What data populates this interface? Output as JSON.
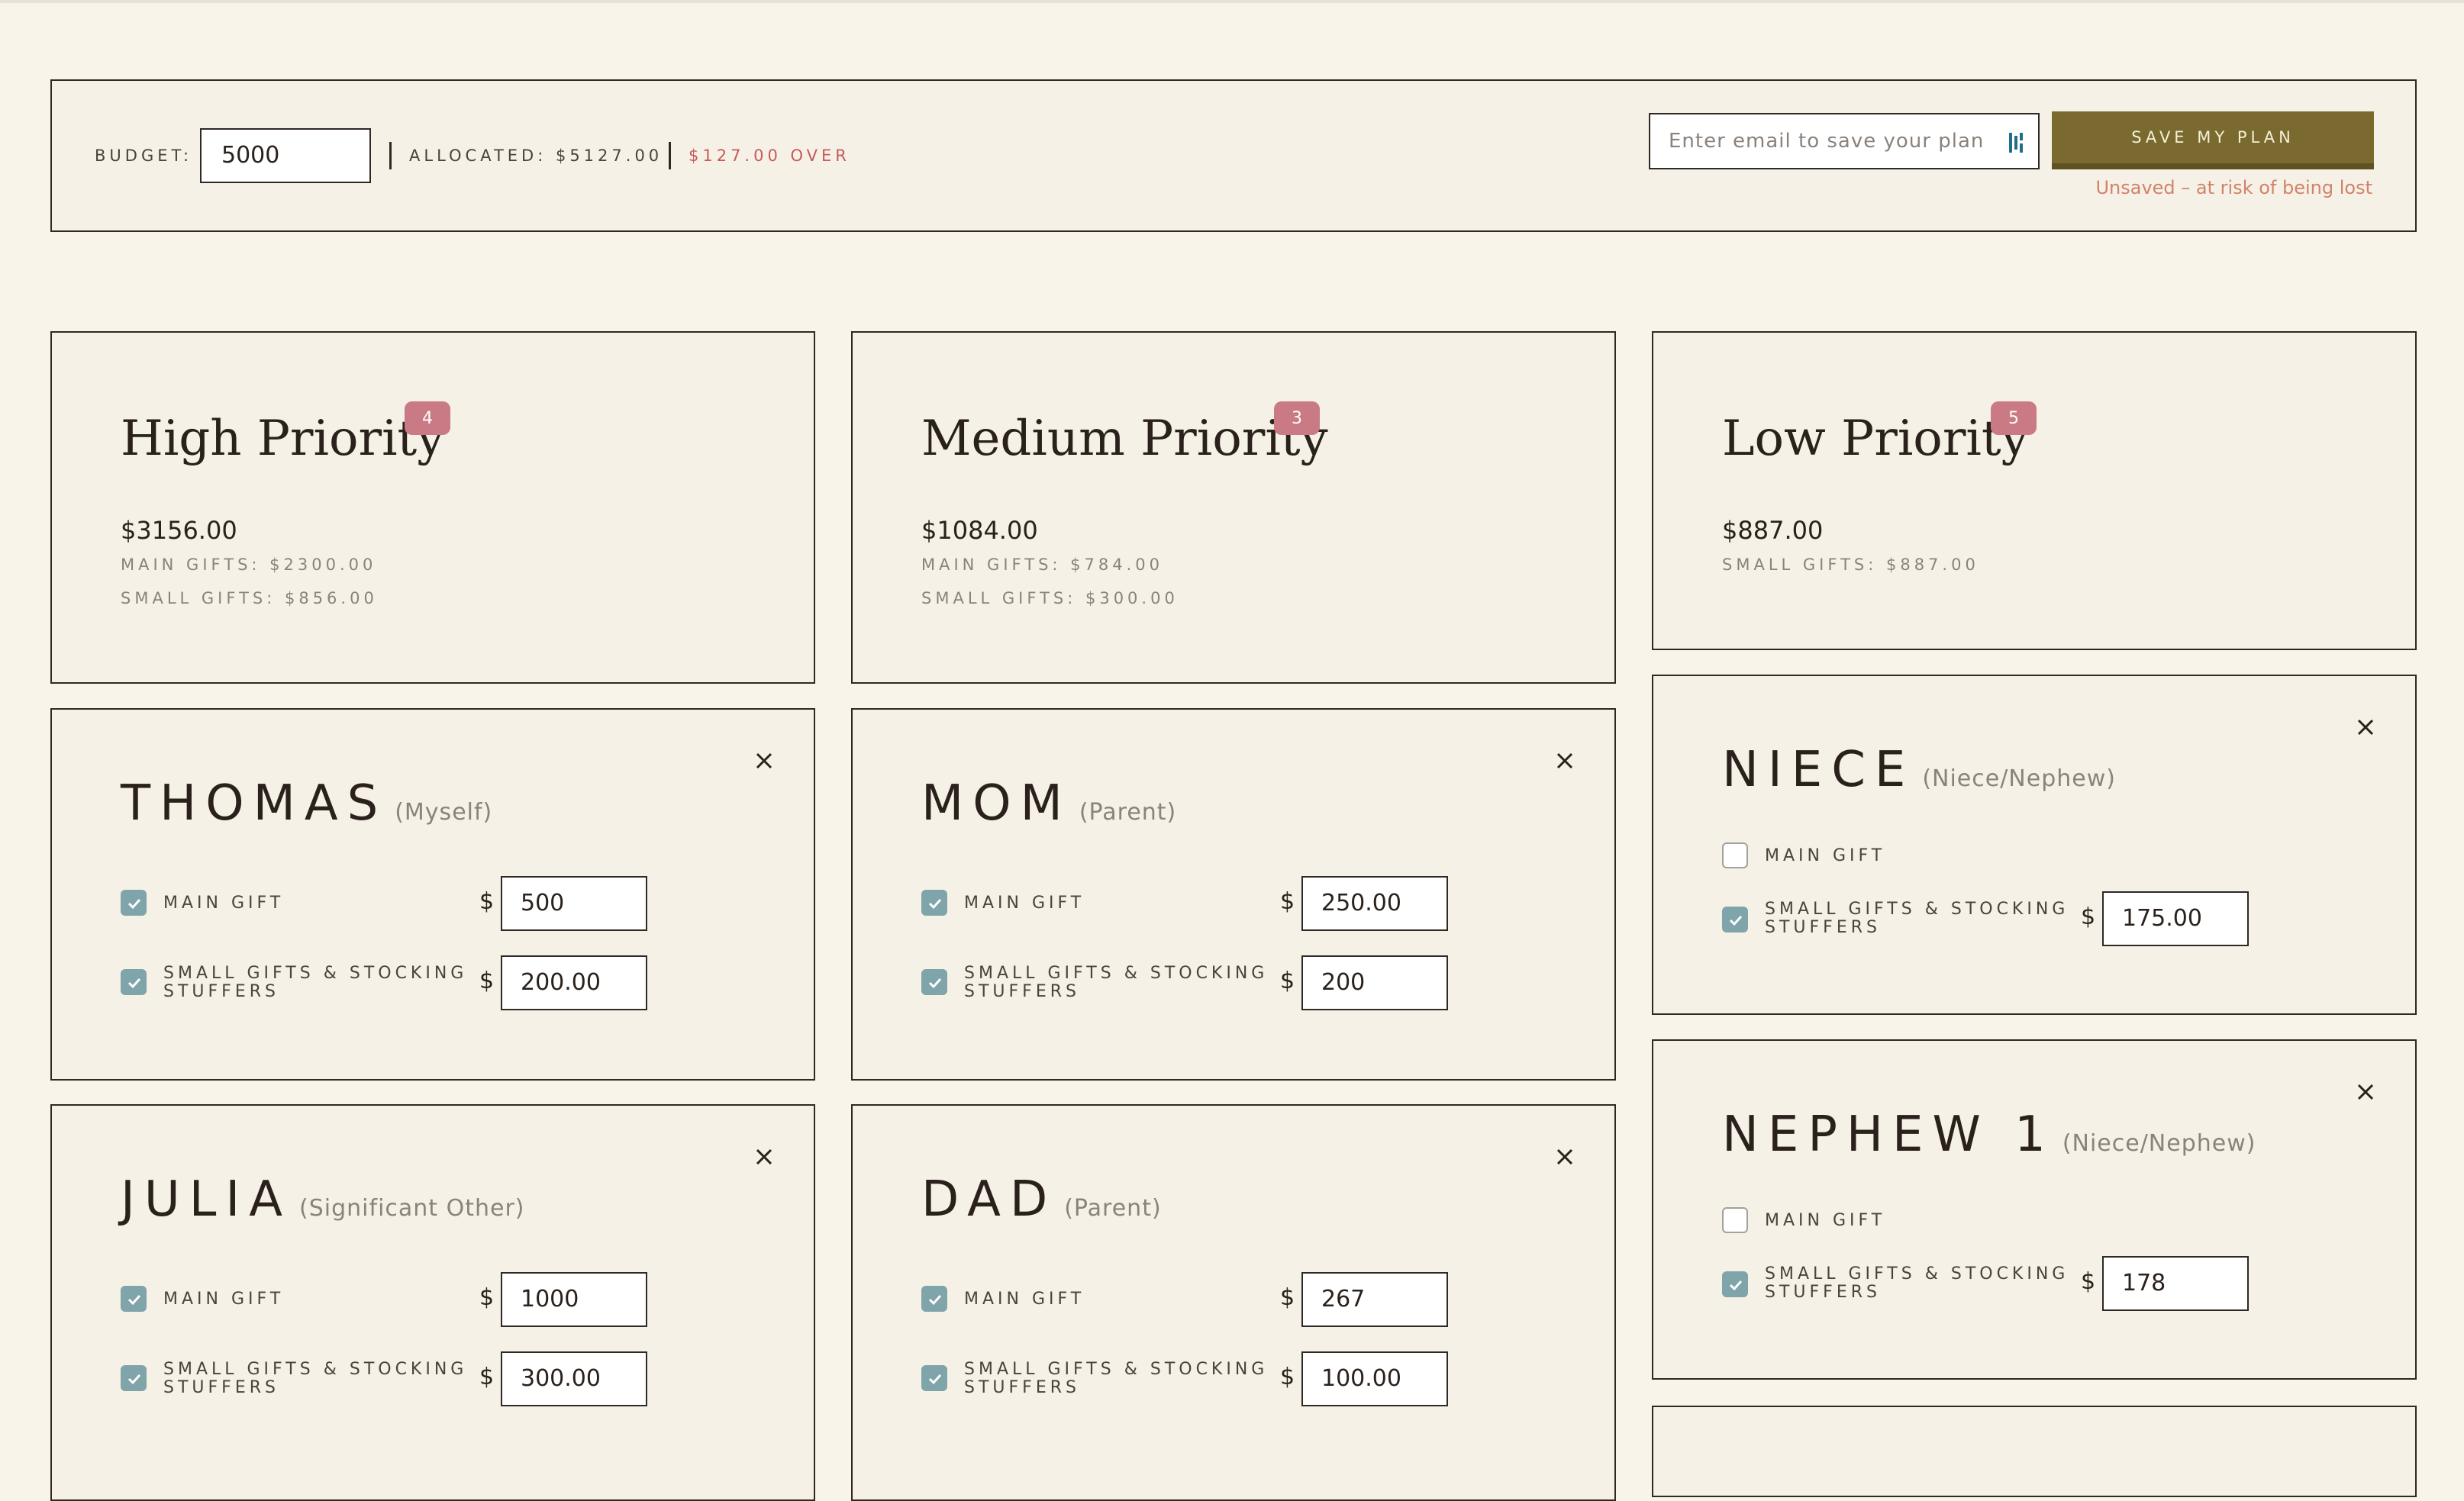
{
  "budget_bar": {
    "budget_label": "BUDGET:",
    "budget_value": "5000",
    "allocated_label": "ALLOCATED:  $5127.00",
    "over_label": "$127.00 OVER",
    "email_placeholder": "Enter email to save your plan",
    "save_label": "SAVE MY PLAN",
    "unsaved_note": "Unsaved – at risk of being lost"
  },
  "priorities": {
    "high": {
      "title": "High Priority",
      "count": "4",
      "total": "$3156.00",
      "main": "MAIN GIFTS: $2300.00",
      "small": "SMALL GIFTS: $856.00"
    },
    "medium": {
      "title": "Medium Priority",
      "count": "3",
      "total": "$1084.00",
      "main": "MAIN GIFTS: $784.00",
      "small": "SMALL GIFTS: $300.00"
    },
    "low": {
      "title": "Low Priority",
      "count": "5",
      "total": "$887.00",
      "small": "SMALL GIFTS: $887.00"
    }
  },
  "labels": {
    "main_gift": "MAIN GIFT",
    "small_gifts": "SMALL GIFTS & STOCKING STUFFERS",
    "dollar": "$"
  },
  "people": {
    "thomas": {
      "name": "THOMAS",
      "relation": "(Myself)",
      "main_checked": true,
      "main": "500",
      "small_checked": true,
      "small": "200.00"
    },
    "mom": {
      "name": "MOM",
      "relation": "(Parent)",
      "main_checked": true,
      "main": "250.00",
      "small_checked": true,
      "small": "200"
    },
    "niece": {
      "name": "NIECE",
      "relation": "(Niece/Nephew)",
      "main_checked": false,
      "small_checked": true,
      "small": "175.00"
    },
    "nephew1": {
      "name": "NEPHEW 1",
      "relation": "(Niece/Nephew)",
      "main_checked": false,
      "small_checked": true,
      "small": "178"
    },
    "julia": {
      "name": "JULIA",
      "relation": "(Significant Other)",
      "main_checked": true,
      "main": "1000",
      "small_checked": true,
      "small": "300.00"
    },
    "dad": {
      "name": "DAD",
      "relation": "(Parent)",
      "main_checked": true,
      "main": "267",
      "small_checked": true,
      "small": "100.00"
    }
  },
  "colors": {
    "accent": "#7a6a2f",
    "badge": "#c97a84",
    "over": "#c85a5a",
    "check": "#7fa4aa",
    "background": "#f8f4e9"
  }
}
